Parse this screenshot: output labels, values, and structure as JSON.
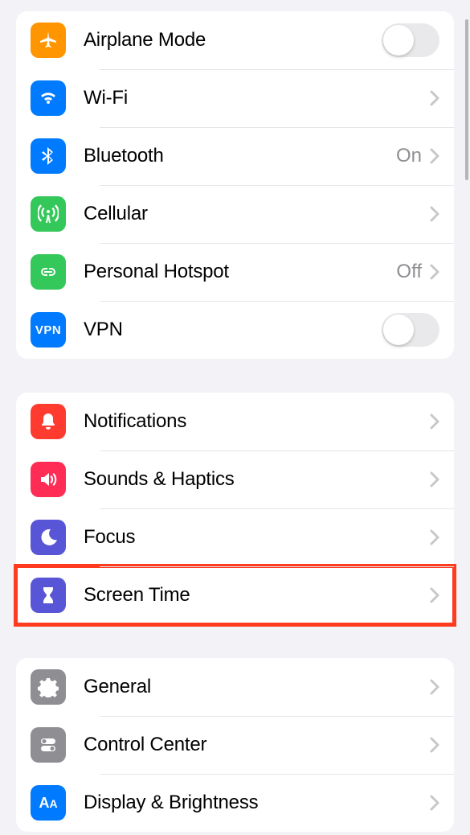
{
  "groups": [
    {
      "id": "connectivity",
      "rows": [
        {
          "id": "airplane-mode",
          "label": "Airplane Mode",
          "icon": "airplane",
          "tint": "bg-orange",
          "accessory": "toggle",
          "toggle_on": false
        },
        {
          "id": "wifi",
          "label": "Wi-Fi",
          "icon": "wifi",
          "tint": "bg-blue",
          "accessory": "disclosure",
          "value": ""
        },
        {
          "id": "bluetooth",
          "label": "Bluetooth",
          "icon": "bluetooth",
          "tint": "bg-blue",
          "accessory": "disclosure",
          "value": "On"
        },
        {
          "id": "cellular",
          "label": "Cellular",
          "icon": "antenna",
          "tint": "bg-green",
          "accessory": "disclosure",
          "value": ""
        },
        {
          "id": "hotspot",
          "label": "Personal Hotspot",
          "icon": "link",
          "tint": "bg-green",
          "accessory": "disclosure",
          "value": "Off"
        },
        {
          "id": "vpn",
          "label": "VPN",
          "icon": "vpn",
          "tint": "bg-blue",
          "accessory": "toggle",
          "toggle_on": false
        }
      ]
    },
    {
      "id": "notifications",
      "rows": [
        {
          "id": "notifications",
          "label": "Notifications",
          "icon": "bell",
          "tint": "bg-red",
          "accessory": "disclosure",
          "value": ""
        },
        {
          "id": "sounds",
          "label": "Sounds & Haptics",
          "icon": "speaker",
          "tint": "bg-pink",
          "accessory": "disclosure",
          "value": ""
        },
        {
          "id": "focus",
          "label": "Focus",
          "icon": "moon",
          "tint": "bg-indigo",
          "accessory": "disclosure",
          "value": ""
        },
        {
          "id": "screen-time",
          "label": "Screen Time",
          "icon": "hourglass",
          "tint": "bg-indigo",
          "accessory": "disclosure",
          "value": "",
          "highlighted": true
        }
      ]
    },
    {
      "id": "general",
      "rows": [
        {
          "id": "general",
          "label": "General",
          "icon": "gear",
          "tint": "bg-gray",
          "accessory": "disclosure",
          "value": ""
        },
        {
          "id": "control-center",
          "label": "Control Center",
          "icon": "switches",
          "tint": "bg-gray",
          "accessory": "disclosure",
          "value": ""
        },
        {
          "id": "display",
          "label": "Display & Brightness",
          "icon": "aa",
          "tint": "bg-blue",
          "accessory": "disclosure",
          "value": ""
        }
      ]
    }
  ]
}
